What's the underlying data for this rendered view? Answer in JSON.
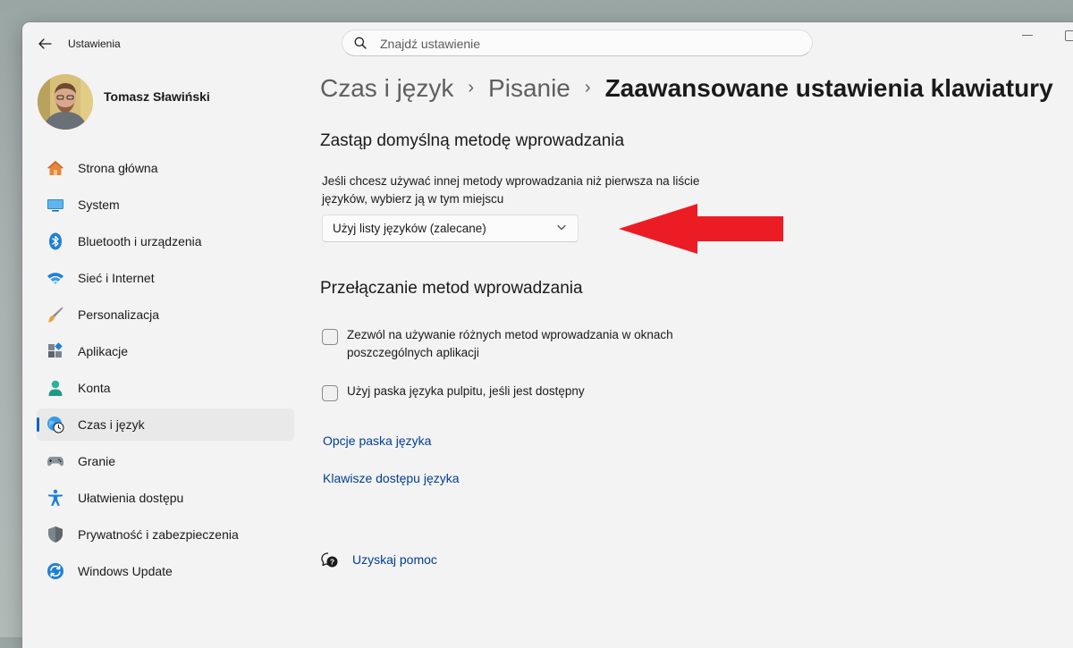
{
  "window": {
    "title": "Ustawienia"
  },
  "search": {
    "placeholder": "Znajdź ustawienie"
  },
  "user": {
    "name": "Tomasz Sławiński"
  },
  "sidebar": {
    "items": [
      {
        "label": "Strona główna",
        "icon": "home-icon"
      },
      {
        "label": "System",
        "icon": "system-icon"
      },
      {
        "label": "Bluetooth i urządzenia",
        "icon": "bluetooth-icon"
      },
      {
        "label": "Sieć i Internet",
        "icon": "wifi-icon"
      },
      {
        "label": "Personalizacja",
        "icon": "brush-icon"
      },
      {
        "label": "Aplikacje",
        "icon": "apps-icon"
      },
      {
        "label": "Konta",
        "icon": "accounts-icon"
      },
      {
        "label": "Czas i język",
        "icon": "time-language-icon",
        "selected": true
      },
      {
        "label": "Granie",
        "icon": "gamepad-icon"
      },
      {
        "label": "Ułatwienia dostępu",
        "icon": "accessibility-icon"
      },
      {
        "label": "Prywatność i zabezpieczenia",
        "icon": "shield-icon"
      },
      {
        "label": "Windows Update",
        "icon": "update-icon"
      }
    ]
  },
  "breadcrumb": {
    "items": [
      "Czas i język",
      "Pisanie",
      "Zaawansowane ustawienia klawiatury"
    ]
  },
  "override_section": {
    "heading": "Zastąp domyślną metodę wprowadzania",
    "description": "Jeśli chcesz używać innej metody wprowadzania niż pierwsza na liście języków, wybierz ją w tym miejscu",
    "dropdown_value": "Użyj listy języków (zalecane)"
  },
  "switching_section": {
    "heading": "Przełączanie metod wprowadzania",
    "checkbox_per_app": "Zezwól na używanie różnych metod wprowadzania w oknach poszczególnych aplikacji",
    "checkbox_language_bar": "Użyj paska języka pulpitu, jeśli jest dostępny",
    "per_app_checked": false,
    "language_bar_checked": false
  },
  "links": {
    "language_bar_options": "Opcje paska języka",
    "hotkeys": "Klawisze dostępu języka",
    "get_help": "Uzyskaj pomoc"
  },
  "colors": {
    "accent": "#0067c0",
    "link": "#003e92",
    "annotation_arrow": "#ec1c24"
  }
}
